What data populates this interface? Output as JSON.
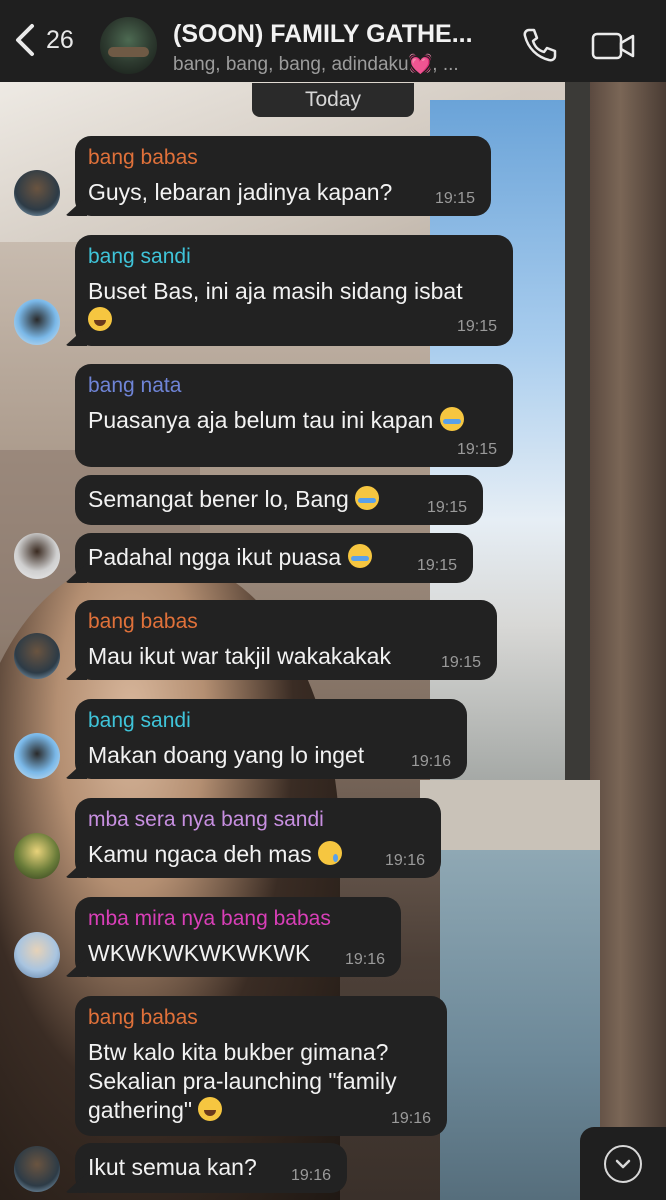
{
  "header": {
    "back_count": "26",
    "title": "(SOON) FAMILY GATHE...",
    "subtitle": "bang, bang, bang, adindaku💓, ..."
  },
  "date_label": "Today",
  "colors": {
    "header_bg": "#1f1f1f",
    "bubble_bg": "#222222",
    "name_orange": "#e0713a",
    "name_cyan": "#3fc4d9",
    "name_blue": "#6f84d6",
    "name_lilac": "#c78fe0",
    "name_magenta": "#d93fb8"
  },
  "messages": [
    {
      "sender": "bang babas",
      "text1": "Guys, lebaran jadinya kapan?",
      "time": "19:15"
    },
    {
      "sender": "bang sandi",
      "text1": "Buset Bas, ini aja masih sidang isbat",
      "time": "19:15",
      "emoji": "laugh"
    },
    {
      "sender": "bang nata",
      "text1": "Puasanya aja belum tau ini kapan",
      "time": "19:15",
      "emoji": "cry"
    },
    {
      "text1": "Semangat bener lo, Bang",
      "time": "19:15",
      "emoji": "cry"
    },
    {
      "text1": "Padahal ngga ikut puasa",
      "time": "19:15",
      "emoji": "cry"
    },
    {
      "sender": "bang babas",
      "text1": "Mau ikut war takjil wakakakak",
      "time": "19:15"
    },
    {
      "sender": "bang sandi",
      "text1": "Makan doang yang lo inget",
      "time": "19:16"
    },
    {
      "sender": "mba sera nya bang sandi",
      "text1": "Kamu ngaca deh mas",
      "time": "19:16",
      "emoji": "tear"
    },
    {
      "sender": "mba mira nya bang babas",
      "text1": "WKWKWKWKWKWK",
      "time": "19:16"
    },
    {
      "sender": "bang babas",
      "text1": "Btw kalo kita bukber gimana?",
      "text2": "Sekalian pra-launching \"family",
      "text3": "gathering\"",
      "time": "19:16",
      "emoji": "laugh"
    },
    {
      "text1": "Ikut semua kan?",
      "time": "19:16"
    }
  ]
}
